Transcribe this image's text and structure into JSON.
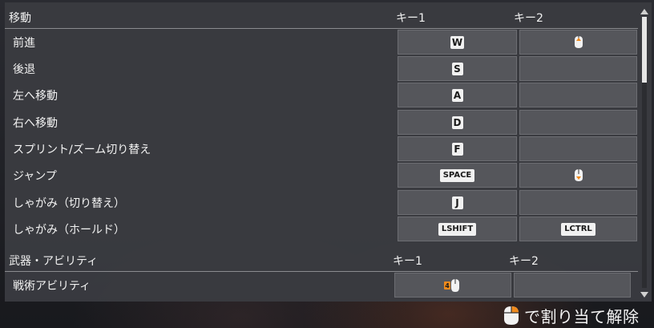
{
  "sections": {
    "movement": {
      "title": "移動",
      "key1_header": "キー1",
      "key2_header": "キー2",
      "rows": [
        {
          "label": "前進",
          "key1": "W",
          "key2_icon": "mouse-button-up-icon"
        },
        {
          "label": "後退",
          "key1": "S",
          "key2_icon": ""
        },
        {
          "label": "左へ移動",
          "key1": "A",
          "key2_icon": ""
        },
        {
          "label": "右へ移動",
          "key1": "D",
          "key2_icon": ""
        },
        {
          "label": "スプリント/ズーム切り替え",
          "key1": "F",
          "key2_icon": ""
        },
        {
          "label": "ジャンプ",
          "key1": "SPACE",
          "key2_icon": "mouse-button-down-icon"
        },
        {
          "label": "しゃがみ（切り替え）",
          "key1": "J",
          "key2_icon": ""
        },
        {
          "label": "しゃがみ（ホールド）",
          "key1": "LSHIFT",
          "key2": "LCTRL"
        }
      ]
    },
    "weapons": {
      "title": "武器・アビリティ",
      "key1_header": "キー1",
      "key2_header": "キー2",
      "rows": [
        {
          "label": "戦術アビリティ",
          "key1_icon": "mouse-button-4-icon",
          "key1_badge": "4"
        }
      ]
    }
  },
  "footer": {
    "icon": "mouse-right-click-icon",
    "label": "で割り当て解除"
  },
  "colors": {
    "accent": "#f08a1c",
    "panel": "#3a3b40",
    "cell": "#55565b"
  }
}
